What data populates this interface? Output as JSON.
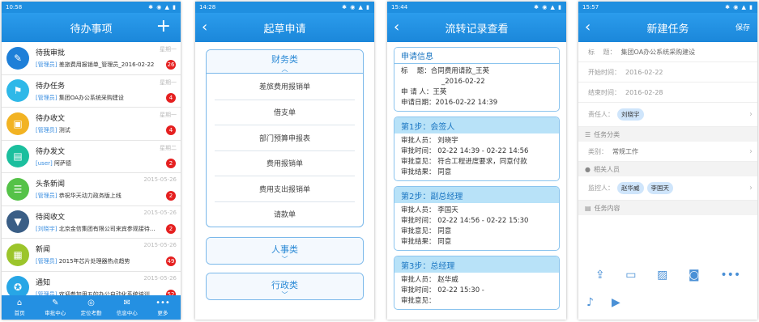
{
  "status": [
    {
      "time": "10:58"
    },
    {
      "time": "14:28"
    },
    {
      "time": "15:44"
    },
    {
      "time": "15:57"
    }
  ],
  "status_icons": "✱ ◉ ▲ ▮",
  "todo": {
    "title": "待办事项",
    "plus": "+",
    "items": [
      {
        "title": "待我审批",
        "user": "[管理员]",
        "text": "差旅费用报销单_管理员_2016-02-22",
        "date": "星期一",
        "badge": "26",
        "color": "#1e7fd8",
        "icon": "✎"
      },
      {
        "title": "待办任务",
        "user": "[管理员]",
        "text": "集团OA办公系统采购建设",
        "date": "星期一",
        "badge": "4",
        "color": "#2eb8e8",
        "icon": "⚑"
      },
      {
        "title": "待办收文",
        "user": "[管理员]",
        "text": "测试",
        "date": "星期一",
        "badge": "4",
        "color": "#f2b323",
        "icon": "▣"
      },
      {
        "title": "待办发文",
        "user": "[user]",
        "text": "阿萨德",
        "date": "星期二",
        "badge": "2",
        "color": "#1bbf9e",
        "icon": "▤"
      },
      {
        "title": "头条新闻",
        "user": "[管理员]",
        "text": "恭祝华天动力政务版上线",
        "date": "2015-05-26",
        "badge": "2",
        "color": "#55c248",
        "icon": "☰"
      },
      {
        "title": "待阅收文",
        "user": "[刘晓宇]",
        "text": "北京金信集团有限公司来宾参观接待…",
        "date": "2015-05-26",
        "badge": "2",
        "color": "#3a5e86",
        "icon": "▼"
      },
      {
        "title": "新闻",
        "user": "[管理员]",
        "text": "2015年芯片处理器热点趋势",
        "date": "2015-05-26",
        "badge": "49",
        "color": "#9cc52b",
        "icon": "▦"
      },
      {
        "title": "通知",
        "user": "[管理员]",
        "text": "欢迎参加用五的办公自动化系统培训",
        "date": "2015-05-26",
        "badge": "52",
        "color": "#27a6e6",
        "icon": "✪"
      }
    ],
    "tabs": [
      {
        "icon": "⌂",
        "label": "首页"
      },
      {
        "icon": "✎",
        "label": "审批中心"
      },
      {
        "icon": "◎",
        "label": "定位考勤"
      },
      {
        "icon": "✉",
        "label": "信息中心"
      },
      {
        "icon": "•••",
        "label": "更多"
      }
    ]
  },
  "draft": {
    "title": "起草申请",
    "back": "‹",
    "finance": {
      "label": "财务类",
      "chev": "︿",
      "items": [
        "差旅费用报销单",
        "借支单",
        "部门预算申报表",
        "费用报销单",
        "费用支出报销单",
        "请款单"
      ]
    },
    "hr": {
      "label": "人事类",
      "chev": "﹀"
    },
    "admin": {
      "label": "行政类",
      "chev": "﹀"
    }
  },
  "flow": {
    "title": "流转记录查看",
    "back": "‹",
    "info": {
      "header": "申请信息",
      "l1": "标　 题：",
      "v1": "合同费用请款_王英",
      "v1b": "_2016-02-22",
      "l2": "申 请 人：",
      "v2": "王英",
      "l3": "申请日期：",
      "v3": "2016-02-22 14:39"
    },
    "steps": [
      {
        "header": "第1步：会签人",
        "person": "审批人员：  刘晓宇",
        "time": "审批时间：  02-22 14:39 - 02-22 14:56",
        "opinion": "审批意见：  符合工程进度要求，同意付款",
        "result": "审批结果：  同意"
      },
      {
        "header": "第2步：副总经理",
        "person": "审批人员：  李国天",
        "time": "审批时间：  02-22 14:56 - 02-22 15:30",
        "opinion": "审批意见：  同意",
        "result": "审批结果：  同意"
      },
      {
        "header": "第3步：总经理",
        "person": "审批人员：  赵华威",
        "time": "审批时间：  02-22 15:30 -",
        "opinion": "审批意见：",
        "result": ""
      }
    ]
  },
  "task": {
    "title": "新建任务",
    "back": "‹",
    "save": "保存",
    "subject_label": "标　 题：",
    "subject": "集团OA办公系统采购建设",
    "start_label": "开始时间：",
    "start": "2016-02-22",
    "end_label": "结束时间：",
    "end": "2016-02-28",
    "owner_label": "责任人：",
    "owner": "刘晓宇",
    "cat_section": "任务分类",
    "cat_label": "类别：",
    "cat": "常规工作",
    "people_section": "相关人员",
    "watch_label": "监控人：",
    "watch1": "赵华威",
    "watch2": "李国天",
    "content_section": "任务内容"
  }
}
